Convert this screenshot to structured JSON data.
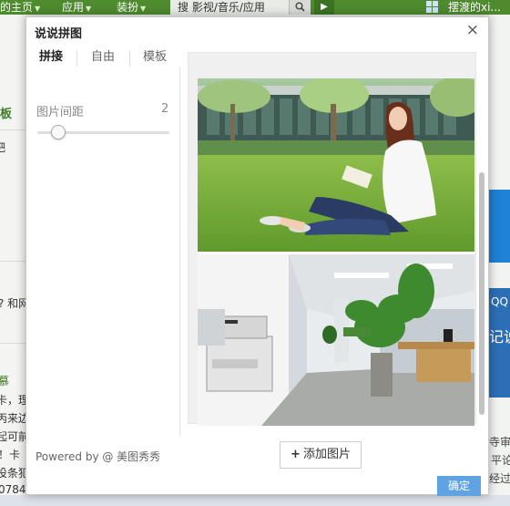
{
  "top_nav": {
    "home_label": "的主页",
    "apps_label": "应用",
    "decorate_label": "装扮",
    "search_text": "搜 影视/音乐/应用",
    "user_name": "摆渡的xi..."
  },
  "background": {
    "left_texts": [
      "板",
      "吧",
      "? 和网",
      "慕",
      "卡，理",
      "丙来边",
      "起可前",
      "！卡",
      "投条犯",
      "0784"
    ],
    "right_texts": [
      "QQ",
      "记说",
      "平论",
      "寺审村",
      "经过"
    ]
  },
  "dialog": {
    "title": "说说拼图",
    "close_label": "×",
    "tabs": [
      "拼接",
      "自由",
      "模板"
    ],
    "spacing_label": "图片间距",
    "spacing_value": "2",
    "powered_by": "Powered by @ 美图秀秀",
    "add_image_label": "添加图片",
    "add_image_icon": "+",
    "confirm_label": "确定"
  },
  "colors": {
    "nav_green": "#4e8a2e",
    "accent_blue": "#5fa3e3",
    "slider_track": "#dedede"
  },
  "icons": {
    "close": "close-icon",
    "search": "search-icon",
    "play": "play-icon",
    "add": "plus-icon",
    "windows": "windows-logo-icon"
  }
}
